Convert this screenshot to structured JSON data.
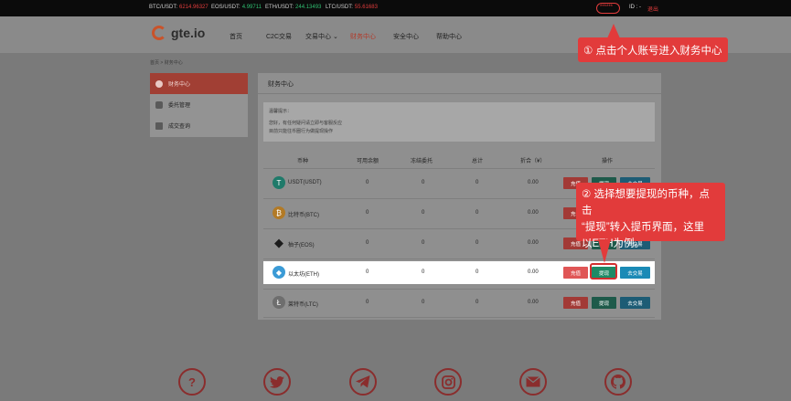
{
  "ticker": [
    {
      "pair": "BTC/USDT:",
      "price": "6214.96327",
      "color": "#e23c3c"
    },
    {
      "pair": "EOS/USDT:",
      "price": "4.99711",
      "color": "#2fbf71"
    },
    {
      "pair": "ETH/USDT:",
      "price": "244.13493",
      "color": "#2fbf71"
    },
    {
      "pair": "LTC/USDT:",
      "price": "55.61683",
      "color": "#e23c3c"
    }
  ],
  "account": {
    "name": "******",
    "id_label": "ID : -",
    "logout": "退出"
  },
  "nav": {
    "logo": "gte.io",
    "items": [
      "首页",
      "C2C交易",
      "交易中心",
      "财务中心",
      "安全中心",
      "帮助中心"
    ],
    "active_index": 3
  },
  "breadcrumb": "首页 > 财务中心",
  "sidebar": {
    "items": [
      "财务中心",
      "委托管理",
      "成交查询"
    ],
    "active_index": 0
  },
  "main": {
    "title": "财务中心",
    "tips": [
      "温馨提示：",
      "您好，有任何疑问请立即与客服反应",
      "目前只能往币圈行为做提现操作"
    ],
    "headers": [
      "币种",
      "可用余额",
      "冻结委托",
      "总计",
      "折合（¥）",
      "操作"
    ],
    "rows": [
      {
        "name": "USDT(USDT)",
        "available": "0",
        "frozen": "0",
        "total": "0",
        "cny": "0.00",
        "icon": "T",
        "color": "#1f7a6a"
      },
      {
        "name": "比特币(BTC)",
        "available": "0",
        "frozen": "0",
        "total": "0",
        "cny": "0.00",
        "icon": "₿",
        "color": "#b27a26"
      },
      {
        "name": "柚子(EOS)",
        "available": "0",
        "frozen": "0",
        "total": "0",
        "cny": "0.00",
        "icon": "◆",
        "color": "#1c1c1c"
      },
      {
        "name": "以太坊(ETH)",
        "available": "0",
        "frozen": "0",
        "total": "0",
        "cny": "0.00",
        "icon": "◆",
        "color": "#3b9bd6"
      },
      {
        "name": "莱特币(LTC)",
        "available": "0",
        "frozen": "0",
        "total": "0",
        "cny": "0.00",
        "icon": "Ł",
        "color": "#6e6e6e"
      }
    ],
    "btn_deposit": "充值",
    "btn_withdraw": "提现",
    "btn_trade": "去交易"
  },
  "callouts": {
    "step1": "① 点击个人账号进入财务中心",
    "step2_lines": [
      "② 选择想要提现的币种，点击",
      "“提现”转入提币界面，这里",
      "以ETH为例。"
    ]
  },
  "footer_icons": [
    "question-icon",
    "twitter-icon",
    "telegram-icon",
    "instagram-icon",
    "mail-icon",
    "github-icon"
  ]
}
